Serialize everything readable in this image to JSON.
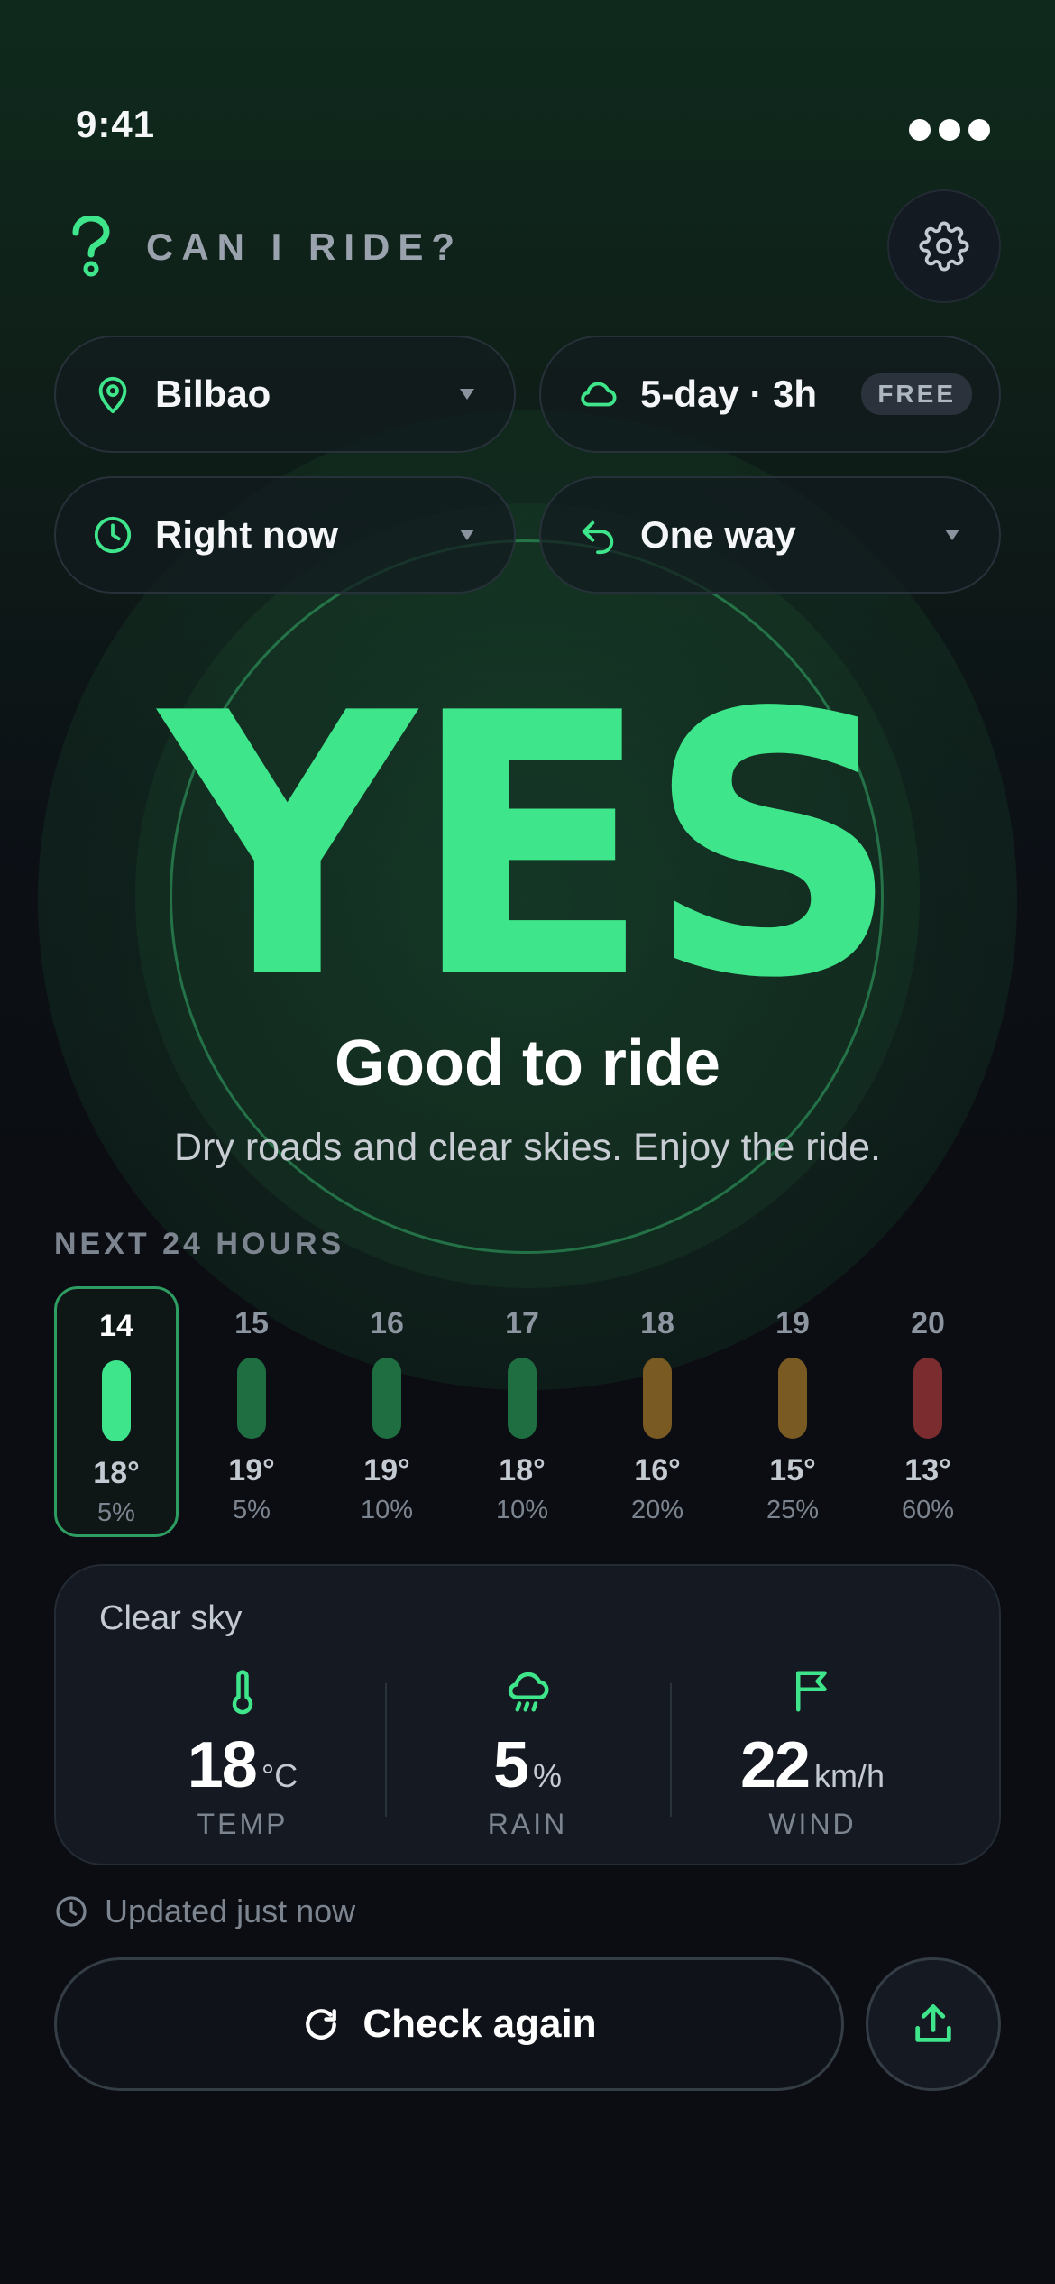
{
  "status_bar": {
    "time": "9:41"
  },
  "header": {
    "title": "CAN I RIDE?"
  },
  "controls": {
    "location": {
      "label": "Bilbao",
      "icon": "map-pin-icon"
    },
    "forecast": {
      "label": "5-day · 3h",
      "badge": "FREE",
      "icon": "cloud-icon"
    },
    "when": {
      "label": "Right now",
      "icon": "clock-icon"
    },
    "trip": {
      "label": "One way",
      "icon": "return-arrow-icon"
    }
  },
  "verdict": {
    "word": "YES",
    "headline": "Good to ride",
    "detail": "Dry roads and clear skies. Enjoy the ride.",
    "color": "#3ee58a"
  },
  "forecast_strip": {
    "title": "NEXT 24 HOURS",
    "hours": [
      {
        "hour": "14",
        "temp": "18°",
        "rain": "5%",
        "color": "#3ee58a",
        "selected": true
      },
      {
        "hour": "15",
        "temp": "19°",
        "rain": "5%",
        "color": "#1f6e42"
      },
      {
        "hour": "16",
        "temp": "19°",
        "rain": "10%",
        "color": "#1f6e42"
      },
      {
        "hour": "17",
        "temp": "18°",
        "rain": "10%",
        "color": "#1f6e42"
      },
      {
        "hour": "18",
        "temp": "16°",
        "rain": "20%",
        "color": "#7a5a23"
      },
      {
        "hour": "19",
        "temp": "15°",
        "rain": "25%",
        "color": "#7a5a23"
      },
      {
        "hour": "20",
        "temp": "13°",
        "rain": "60%",
        "color": "#7a2c2f"
      }
    ]
  },
  "conditions": {
    "summary": "Clear sky",
    "stats": [
      {
        "icon": "thermometer-icon",
        "value": "18",
        "unit": "°C",
        "label": "TEMP"
      },
      {
        "icon": "rain-cloud-icon",
        "value": "5",
        "unit": "%",
        "label": "RAIN"
      },
      {
        "icon": "flag-icon",
        "value": "22",
        "unit": "km/h",
        "label": "WIND"
      }
    ]
  },
  "footer": {
    "updated": "Updated just now",
    "check_again": "Check again"
  }
}
